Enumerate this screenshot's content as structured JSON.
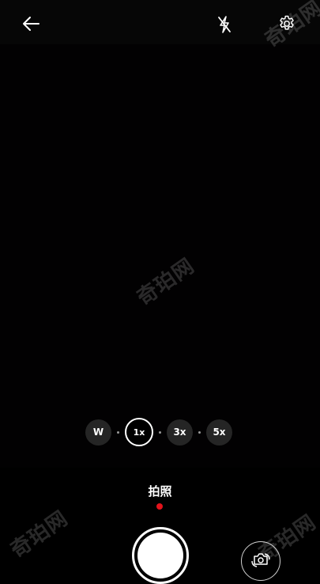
{
  "top_bar": {
    "back_icon": "arrow-left-icon",
    "flash_icon": "flash-off-icon",
    "settings_icon": "gear-icon"
  },
  "zoom": {
    "options": [
      "W",
      "1x",
      "3x",
      "5x"
    ],
    "selected": "1x"
  },
  "mode": {
    "label": "拍照"
  },
  "controls": {
    "shutter_icon": "shutter-button",
    "switch_camera_icon": "camera-rotate-icon"
  },
  "watermark": {
    "text": "奇珀网"
  },
  "colors": {
    "background": "#000000",
    "mode_indicator": "#e3131b",
    "zoom_button_bg": "#252525"
  }
}
